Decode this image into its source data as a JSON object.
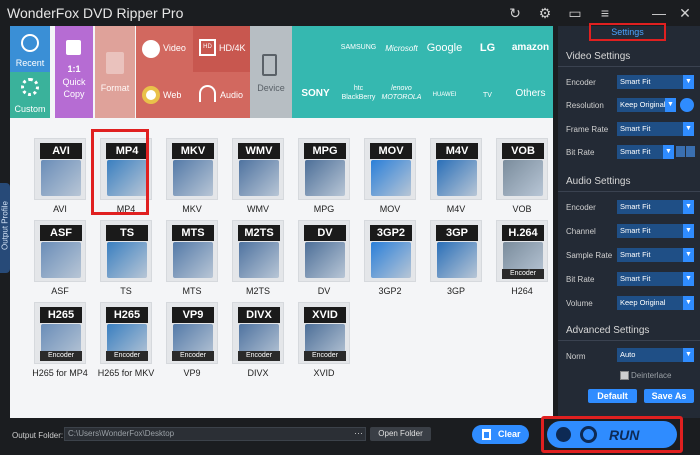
{
  "window": {
    "title": "WonderFox DVD Ripper Pro"
  },
  "titlebar_icons": [
    "refresh-icon",
    "gear-icon",
    "chat-icon",
    "menu-icon",
    "minimize-icon",
    "close-icon"
  ],
  "side_tab": {
    "label": "Output Profile"
  },
  "categories": {
    "recent": "Recent",
    "custom": "Custom",
    "quick_copy": [
      "1:1",
      "Quick",
      "Copy"
    ],
    "format": "Format",
    "video": "Video",
    "hd4k": "HD/4K",
    "web": "Web",
    "audio": "Audio",
    "device": "Device"
  },
  "brands": [
    "SAMSUNG",
    "Microsoft",
    "Google",
    "LG",
    "amazon",
    "SONY",
    "htc BlackBerry",
    "lenovo MOTOROLA",
    "HUAWEI",
    "TV",
    "Others"
  ],
  "formats": [
    {
      "code": "AVI",
      "name": "AVI"
    },
    {
      "code": "MP4",
      "name": "MP4"
    },
    {
      "code": "MKV",
      "name": "MKV"
    },
    {
      "code": "WMV",
      "name": "WMV"
    },
    {
      "code": "MPG",
      "name": "MPG"
    },
    {
      "code": "MOV",
      "name": "MOV"
    },
    {
      "code": "M4V",
      "name": "M4V"
    },
    {
      "code": "VOB",
      "name": "VOB"
    },
    {
      "code": "ASF",
      "name": "ASF"
    },
    {
      "code": "TS",
      "name": "TS"
    },
    {
      "code": "MTS",
      "name": "MTS"
    },
    {
      "code": "M2TS",
      "name": "M2TS"
    },
    {
      "code": "DV",
      "name": "DV"
    },
    {
      "code": "3GP2",
      "name": "3GP2"
    },
    {
      "code": "3GP",
      "name": "3GP"
    },
    {
      "code": "H.264",
      "name": "H264",
      "sub": "Encoder"
    },
    {
      "code": "H265",
      "name": "H265 for MP4",
      "sub": "Encoder"
    },
    {
      "code": "H265",
      "name": "H265 for MKV",
      "sub": "Encoder"
    },
    {
      "code": "VP9",
      "name": "VP9",
      "sub": "Encoder"
    },
    {
      "code": "DIVX",
      "name": "DIVX",
      "sub": "Encoder"
    },
    {
      "code": "XVID",
      "name": "XVID",
      "sub": "Encoder"
    }
  ],
  "settings": {
    "tab_label": "Settings",
    "video_title": "Video Settings",
    "video": [
      {
        "label": "Encoder",
        "value": "Smart Fit"
      },
      {
        "label": "Resolution",
        "value": "Keep Original"
      },
      {
        "label": "Frame Rate",
        "value": "Smart Fit"
      },
      {
        "label": "Bit Rate",
        "value": "Smart Fit"
      }
    ],
    "audio_title": "Audio Settings",
    "audio": [
      {
        "label": "Encoder",
        "value": "Smart Fit"
      },
      {
        "label": "Channel",
        "value": "Smart Fit"
      },
      {
        "label": "Sample Rate",
        "value": "Smart Fit"
      },
      {
        "label": "Bit Rate",
        "value": "Smart Fit"
      },
      {
        "label": "Volume",
        "value": "Keep Original"
      }
    ],
    "advanced_title": "Advanced Settings",
    "norm_label": "Norm",
    "norm_value": "Auto",
    "deinterlace": "Deinterlace",
    "default_btn": "Default",
    "save_as_btn": "Save As"
  },
  "bottom": {
    "output_label": "Output Folder:",
    "output_path": "C:\\Users\\WonderFox\\Desktop",
    "dots": "···",
    "open_folder": "Open Folder",
    "clear": "Clear",
    "run": "RUN"
  },
  "colors": {
    "accent": "#2f8cff",
    "highlight": "#e02020",
    "panel_dark": "#232a35",
    "brand_teal": "#35b8b0"
  }
}
